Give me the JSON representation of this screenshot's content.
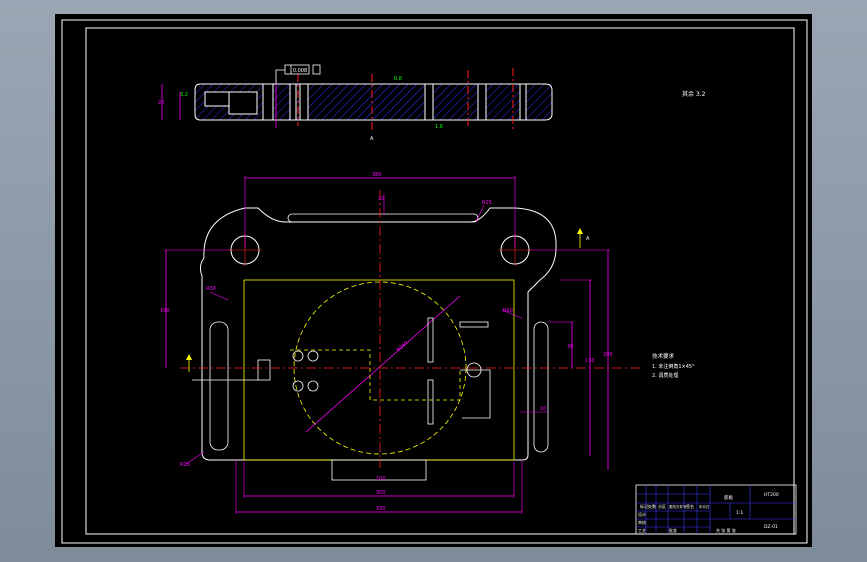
{
  "colors": {
    "background": "#000000",
    "outline": "#ffffff",
    "dimension": "#ff00ff",
    "center_line": "#ff2020",
    "hidden_line": "#ffff00",
    "hatch": "#3030ff",
    "annotation": "#00ff00",
    "title_block": "#3a3aff"
  },
  "top_view": {
    "tolerance_box": "0.008",
    "left_height_dim": "20",
    "roughness_left": "3.2",
    "roughness_mid": "0.8",
    "roughness_right": "1.6",
    "section_label": "A",
    "corner_note": "其余 3.2"
  },
  "plan_view": {
    "overall_width_top": "380",
    "overall_width_bottom": "330",
    "inner_width_bottom": "300",
    "groove_bottom": "100",
    "left_height": "160",
    "right_height_outer": "200",
    "right_height_inner": "130",
    "right_small_dim": "30",
    "right_depth": "10",
    "diameter_label": "Φ260",
    "radius_top_right": "R25",
    "radius_left": "R30",
    "radius_bottom_left": "R20",
    "radius_right": "R60",
    "slot_dim": "10",
    "top_section_arrow": "A"
  },
  "tech_notes": {
    "title": "技术要求",
    "line1": "1. 未注倒角1×45°",
    "line2": "2. 调质处理"
  },
  "title_block": {
    "part_name": "底板",
    "material": "HT200",
    "scale": "1:1",
    "drawing_no": "DZ-01",
    "labels": [
      "标记",
      "处数",
      "分区",
      "更改文件号",
      "签名",
      "年月日"
    ],
    "roles": [
      "设计",
      "审核",
      "工艺",
      "批准"
    ],
    "footer": "共 张 第 张"
  }
}
